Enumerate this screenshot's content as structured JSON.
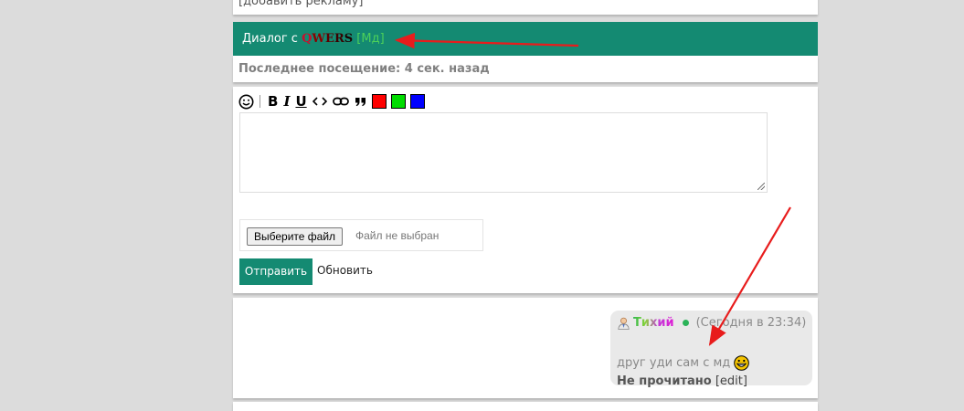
{
  "ad": {
    "link": "[добавить рекламу]"
  },
  "dialog": {
    "prefix": "Диалог с",
    "nick": {
      "q": "Q",
      "w": "W",
      "e": "E",
      "r": "R",
      "s": "S"
    },
    "rank": "[Мд]",
    "last_seen": "Последнее посещение: 4 сек. назад"
  },
  "toolbar": {
    "items": [
      "☺",
      "|",
      "B",
      "I",
      "U",
      "‹›",
      "link",
      "❞"
    ],
    "colors": [
      "#ff0000",
      "#00dd00",
      "#0000ff"
    ]
  },
  "compose": {
    "message_value": "",
    "file_button": "Выберите файл",
    "file_status": "Файл не выбран",
    "send": "Отправить",
    "refresh": "Обновить"
  },
  "message": {
    "user": "Тихий",
    "time": "(Сегодня в 23:34)",
    "text": "друг уди сам с мд",
    "status": "Не прочитано",
    "edit": "[edit]"
  },
  "colors": {
    "accent": "#148a72",
    "annotation_arrow": "#e81c1c"
  }
}
